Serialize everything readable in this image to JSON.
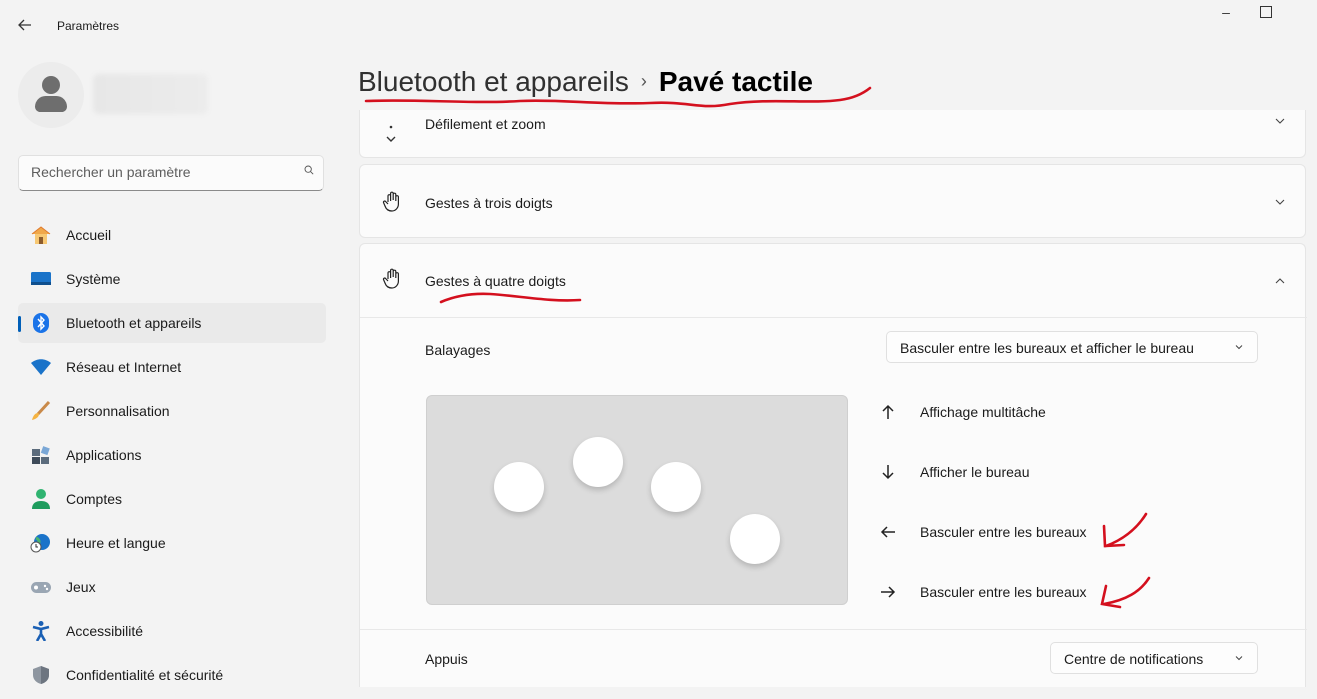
{
  "window": {
    "title": "Paramètres",
    "back_icon": "arrow-left-icon",
    "minimize_icon": "minimize-icon",
    "maximize_icon": "maximize-icon"
  },
  "search": {
    "placeholder": "Rechercher un paramètre",
    "icon": "search-icon"
  },
  "sidebar": {
    "items": [
      {
        "label": "Accueil",
        "icon": "home-icon",
        "active": false
      },
      {
        "label": "Système",
        "icon": "monitor-icon",
        "active": false
      },
      {
        "label": "Bluetooth et appareils",
        "icon": "bluetooth-icon",
        "active": true
      },
      {
        "label": "Réseau et Internet",
        "icon": "wifi-icon",
        "active": false
      },
      {
        "label": "Personnalisation",
        "icon": "brush-icon",
        "active": false
      },
      {
        "label": "Applications",
        "icon": "apps-icon",
        "active": false
      },
      {
        "label": "Comptes",
        "icon": "person-icon",
        "active": false
      },
      {
        "label": "Heure et langue",
        "icon": "globe-clock-icon",
        "active": false
      },
      {
        "label": "Jeux",
        "icon": "gamepad-icon",
        "active": false
      },
      {
        "label": "Accessibilité",
        "icon": "accessibility-icon",
        "active": false
      },
      {
        "label": "Confidentialité et sécurité",
        "icon": "shield-icon",
        "active": false
      }
    ]
  },
  "header": {
    "parent": "Bluetooth et appareils",
    "separator": "›",
    "current": "Pavé tactile"
  },
  "sections": {
    "scroll_zoom": {
      "label": "Défilement et zoom",
      "icon": "scroll-icon",
      "expanded": false
    },
    "three_finger": {
      "label": "Gestes à trois doigts",
      "icon": "hand-icon",
      "expanded": false
    },
    "four_finger": {
      "label": "Gestes à quatre doigts",
      "icon": "hand-icon",
      "expanded": true,
      "swipes": {
        "label": "Balayages",
        "value": "Basculer entre les bureaux et afficher le bureau"
      },
      "gestures": [
        {
          "direction": "up",
          "icon": "arrow-up-icon",
          "label": "Affichage multitâche"
        },
        {
          "direction": "down",
          "icon": "arrow-down-icon",
          "label": "Afficher le bureau"
        },
        {
          "direction": "left",
          "icon": "arrow-left-icon",
          "label": "Basculer entre les bureaux"
        },
        {
          "direction": "right",
          "icon": "arrow-right-icon",
          "label": "Basculer entre les bureaux"
        }
      ],
      "taps": {
        "label": "Appuis",
        "value": "Centre de notifications"
      }
    }
  },
  "colors": {
    "accent": "#005fb8",
    "annotation": "#d4101e",
    "background": "#f3f3f3",
    "card": "#fbfbfb"
  }
}
